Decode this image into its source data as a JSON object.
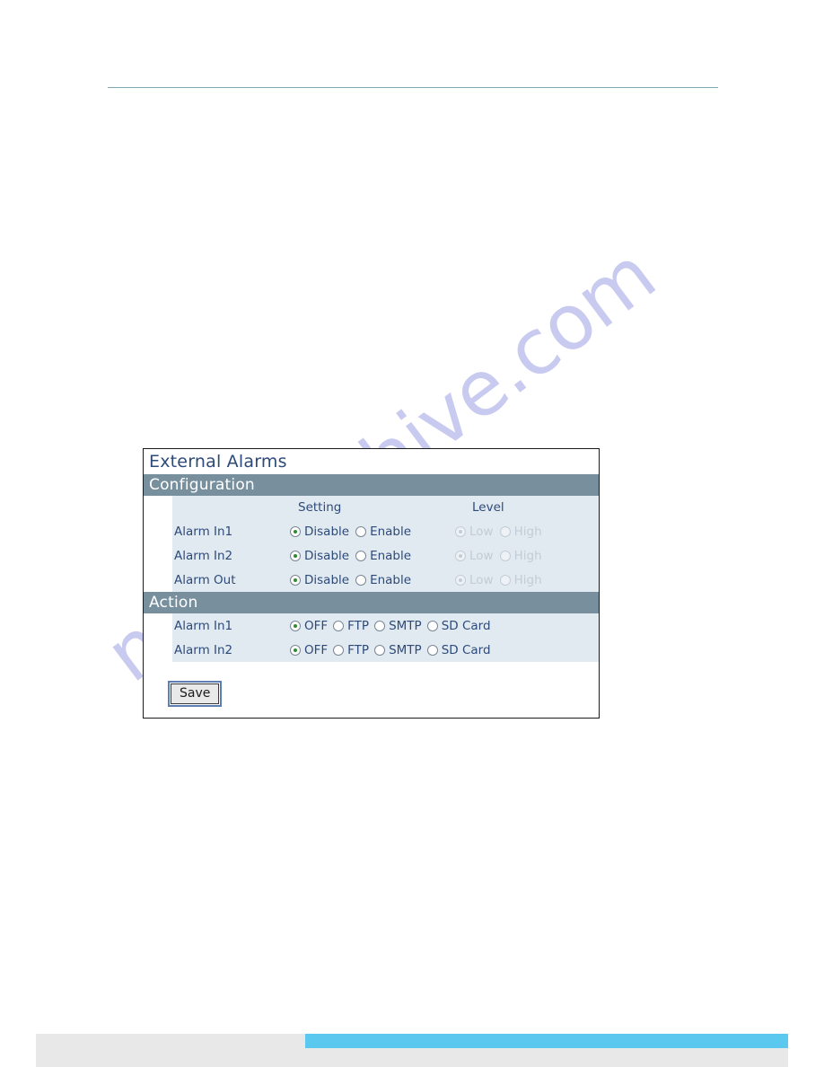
{
  "page": {
    "watermark": "manualshive.com",
    "rule_color": "#7fa8b4",
    "footer_accent_color": "#5bc8ef",
    "footer_bar_color": "#e8e8e8"
  },
  "panel": {
    "title": "External Alarms",
    "accent_header_color": "#78909e",
    "row_background_color": "#e2eaf1",
    "label_color": "#2d4a79",
    "selected_radio_color": "#2e8b2e",
    "sections": [
      {
        "name": "Configuration",
        "columns": [
          "",
          "Setting",
          "Level"
        ],
        "rows": [
          {
            "label": "Alarm In1",
            "setting": [
              {
                "label": "Disable",
                "checked": true,
                "disabled": false
              },
              {
                "label": "Enable",
                "checked": false,
                "disabled": false
              }
            ],
            "level": [
              {
                "label": "Low",
                "checked": true,
                "disabled": true
              },
              {
                "label": "High",
                "checked": false,
                "disabled": true
              }
            ]
          },
          {
            "label": "Alarm In2",
            "setting": [
              {
                "label": "Disable",
                "checked": true,
                "disabled": false
              },
              {
                "label": "Enable",
                "checked": false,
                "disabled": false
              }
            ],
            "level": [
              {
                "label": "Low",
                "checked": true,
                "disabled": true
              },
              {
                "label": "High",
                "checked": false,
                "disabled": true
              }
            ]
          },
          {
            "label": "Alarm Out",
            "setting": [
              {
                "label": "Disable",
                "checked": true,
                "disabled": false
              },
              {
                "label": "Enable",
                "checked": false,
                "disabled": false
              }
            ],
            "level": [
              {
                "label": "Low",
                "checked": true,
                "disabled": true
              },
              {
                "label": "High",
                "checked": false,
                "disabled": true
              }
            ]
          }
        ]
      },
      {
        "name": "Action",
        "rows": [
          {
            "label": "Alarm In1",
            "options": [
              {
                "label": "OFF",
                "checked": true,
                "disabled": false
              },
              {
                "label": "FTP",
                "checked": false,
                "disabled": false
              },
              {
                "label": "SMTP",
                "checked": false,
                "disabled": false
              },
              {
                "label": "SD Card",
                "checked": false,
                "disabled": false
              }
            ]
          },
          {
            "label": "Alarm In2",
            "options": [
              {
                "label": "OFF",
                "checked": true,
                "disabled": false
              },
              {
                "label": "FTP",
                "checked": false,
                "disabled": false
              },
              {
                "label": "SMTP",
                "checked": false,
                "disabled": false
              },
              {
                "label": "SD Card",
                "checked": false,
                "disabled": false
              }
            ]
          }
        ]
      }
    ],
    "save_label": "Save"
  }
}
